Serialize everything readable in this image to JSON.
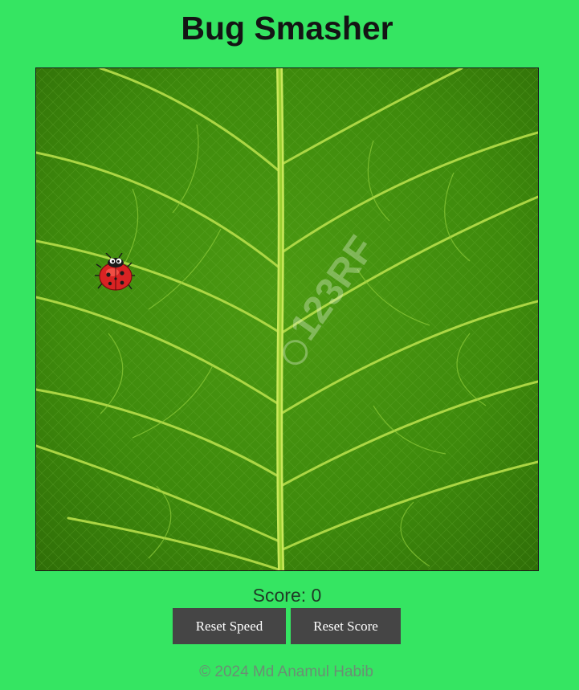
{
  "game": {
    "title": "Bug Smasher",
    "score_label": "Score: 0",
    "score": 0,
    "bug_icon": "ladybug-icon",
    "board_background": "green-leaf-texture",
    "watermark": "123RF"
  },
  "controls": {
    "reset_speed_label": "Reset Speed",
    "reset_score_label": "Reset Score"
  },
  "footer": {
    "copyright": "© 2024 Md Anamul Habib"
  },
  "colors": {
    "page_background": "#35e562",
    "button_background": "#454545",
    "title_color": "#141414"
  }
}
